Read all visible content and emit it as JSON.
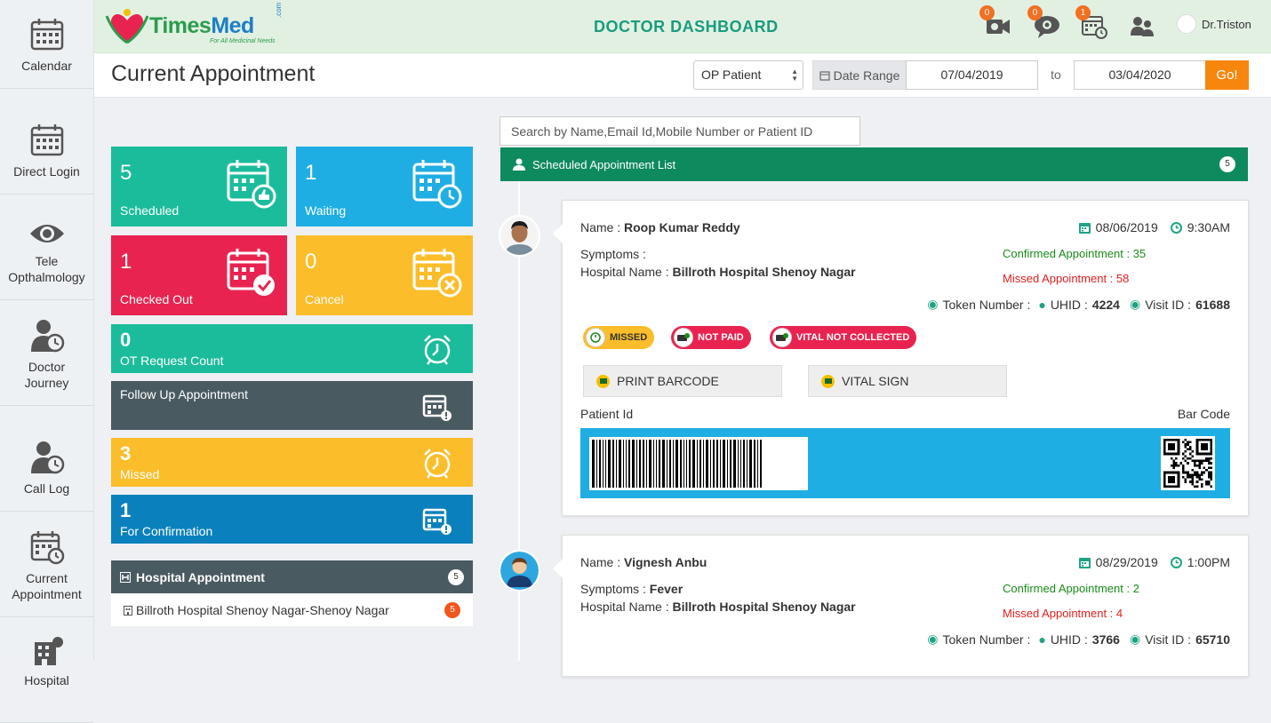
{
  "sidebar": {
    "items": [
      {
        "label": "Calendar",
        "icon": "calendar-icon"
      },
      {
        "label": "Direct Login",
        "icon": "calendar-icon"
      },
      {
        "label": "Tele Opthalmology",
        "icon": "eye-icon"
      },
      {
        "label": "Doctor Journey",
        "icon": "user-clock-icon"
      },
      {
        "label": "Call Log",
        "icon": "user-clock-icon"
      },
      {
        "label": "Current Appointment",
        "icon": "calendar-clock-icon"
      },
      {
        "label": "Hospital",
        "icon": "hospital-icon"
      }
    ]
  },
  "header": {
    "logo_name_a": "Times",
    "logo_name_b": "Med",
    "logo_com": ".com",
    "logo_tagline": "For All Medicinal Needs",
    "title": "DOCTOR DASHBOARD",
    "icons": [
      {
        "name": "video-call-icon",
        "badge": "0"
      },
      {
        "name": "chat-icon",
        "badge": "0"
      },
      {
        "name": "calendar-alert-icon",
        "badge": "1"
      },
      {
        "name": "users-icon",
        "badge": ""
      }
    ],
    "user": "Dr.Triston"
  },
  "page": {
    "title": "Current Appointment"
  },
  "filters": {
    "patient_type": "OP Patient",
    "date_range_label": "Date Range",
    "from": "07/04/2019",
    "to_label": "to",
    "to": "03/04/2020",
    "go": "Go!"
  },
  "stats": {
    "scheduled": {
      "count": "5",
      "label": "Scheduled",
      "color": "#1bbc9b"
    },
    "waiting": {
      "count": "1",
      "label": "Waiting",
      "color": "#1eaee3"
    },
    "checked_out": {
      "count": "1",
      "label": "Checked Out",
      "color": "#e9234f"
    },
    "cancel": {
      "count": "0",
      "label": "Cancel",
      "color": "#fbbd2a"
    }
  },
  "strips": {
    "ot": {
      "count": "0",
      "label": "OT Request Count"
    },
    "follow_up": {
      "label": "Follow Up Appointment"
    },
    "missed": {
      "count": "3",
      "label": "Missed"
    },
    "confirmation": {
      "count": "1",
      "label": "For Confirmation"
    }
  },
  "hospital_appointment": {
    "title": "Hospital Appointment",
    "count": "5",
    "rows": [
      {
        "name": "Billroth Hospital Shenoy Nagar-Shenoy Nagar",
        "count": "5"
      }
    ]
  },
  "search": {
    "placeholder": "Search by Name,Email Id,Mobile Number or Patient ID"
  },
  "scheduled_list": {
    "title": "Scheduled Appointment List",
    "count": "5"
  },
  "labels": {
    "name": "Name :",
    "symptoms": "Symptoms :",
    "hospital": "Hospital Name :",
    "token": "Token Number :",
    "uhid": "UHID :",
    "visit": "Visit ID :",
    "patient_id": "Patient Id",
    "bar_code": "Bar Code",
    "print": "PRINT BARCODE",
    "vital": "VITAL SIGN"
  },
  "appointments": [
    {
      "name": "Roop Kumar Reddy",
      "symptoms": "",
      "hospital": "Billroth Hospital Shenoy Nagar",
      "date": "08/06/2019",
      "time": "9:30AM",
      "confirmed": "Confirmed Appointment : 35",
      "missed": "Missed Appointment : 58",
      "uhid": "4224",
      "visit_id": "61688",
      "tags": [
        {
          "label": "MISSED",
          "bg": "#fbbd2a",
          "fg": "#333"
        },
        {
          "label": "NOT PAID",
          "bg": "#e9234f",
          "fg": "#fff"
        },
        {
          "label": "VITAL NOT COLLECTED",
          "bg": "#e9234f",
          "fg": "#fff"
        }
      ]
    },
    {
      "name": "Vignesh Anbu",
      "symptoms": "Fever",
      "hospital": "Billroth Hospital Shenoy Nagar",
      "date": "08/29/2019",
      "time": "1:00PM",
      "confirmed": "Confirmed Appointment : 2",
      "missed": "Missed Appointment : 4",
      "uhid": "3766",
      "visit_id": "65710"
    }
  ]
}
